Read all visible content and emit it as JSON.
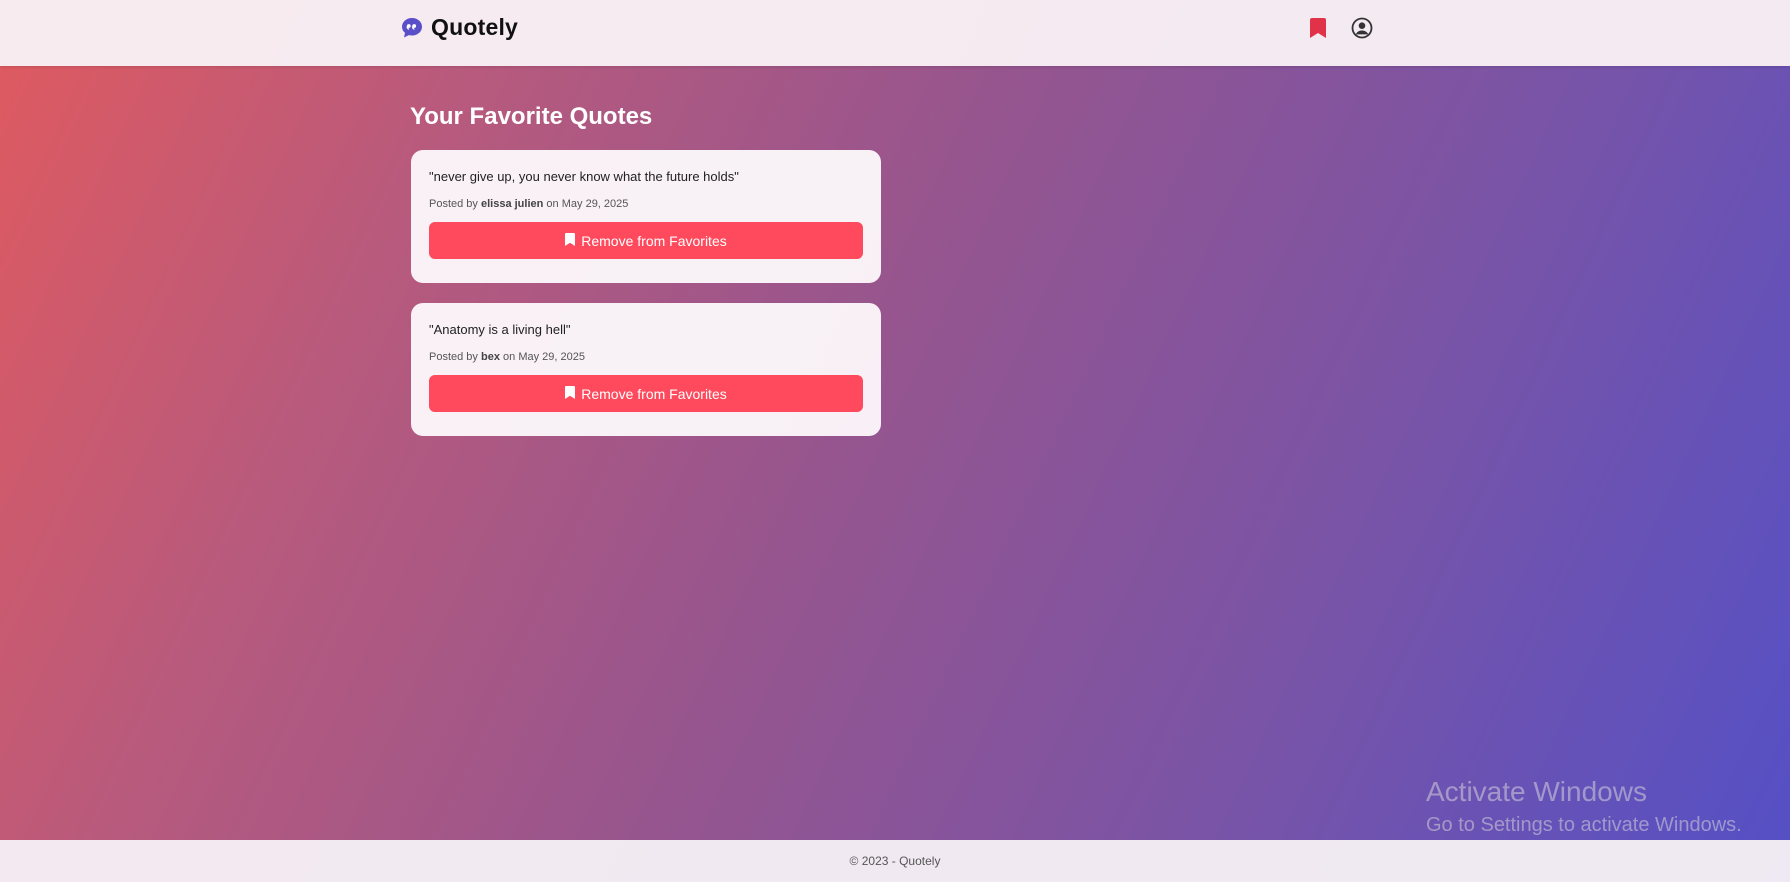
{
  "navbar": {
    "brand_icon": "quote-bubble-icon",
    "brand_name": "Quotely",
    "brand_color": "#5b4fc9",
    "favorites_icon": "bookmark-icon",
    "favorites_color": "#e0334a",
    "profile_icon": "user-circle-icon"
  },
  "main": {
    "title": "Your Favorite Quotes",
    "posted_by_prefix": "Posted by",
    "date_prefix": "on",
    "quotes": [
      {
        "text": "\"never give up, you never know what the future holds\"",
        "author": "elissa julien",
        "date": "May 29, 2025",
        "button_label": "Remove from Favorites",
        "button_icon": "bookmark-icon"
      },
      {
        "text": "\"Anatomy is a living hell\"",
        "author": "bex",
        "date": "May 29, 2025",
        "button_label": "Remove from Favorites",
        "button_icon": "bookmark-icon"
      }
    ]
  },
  "footer": {
    "text": "© 2023 - Quotely"
  },
  "watermark": {
    "title": "Activate Windows",
    "subtitle": "Go to Settings to activate Windows."
  },
  "colors": {
    "button": "#fe4a5c",
    "gradient_start": "#e05a5f",
    "gradient_end": "#5450c6"
  }
}
